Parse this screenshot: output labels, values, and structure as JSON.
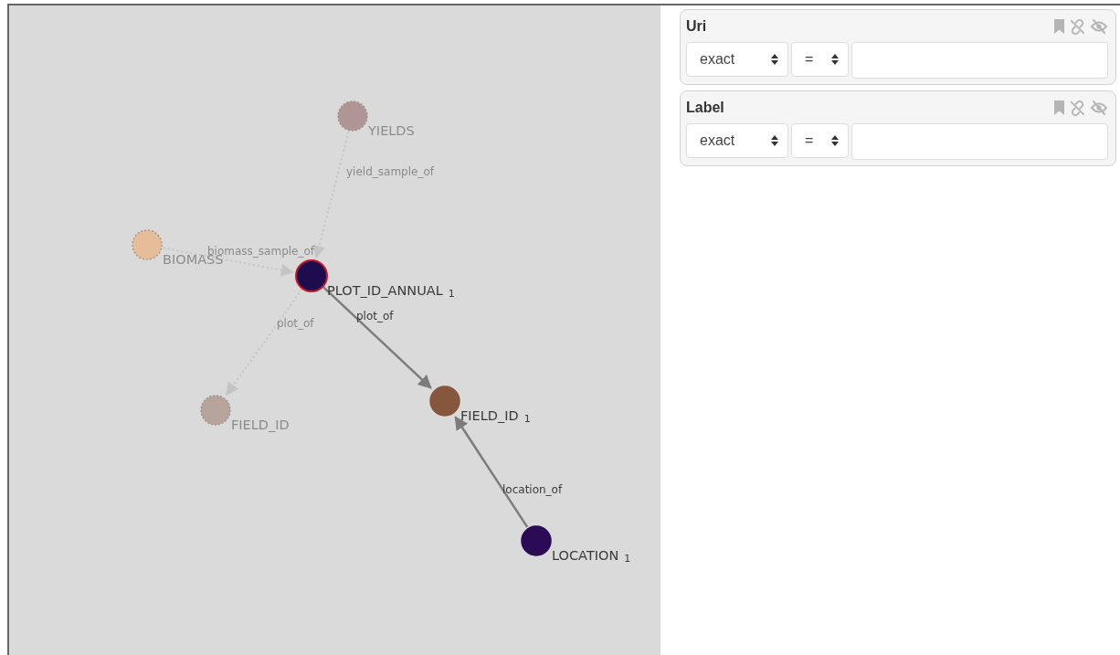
{
  "graph": {
    "nodes": [
      {
        "label": "YIELDS",
        "color": "#a98a8a",
        "faded": true,
        "selected": false
      },
      {
        "label": "BIOMASS",
        "color": "#e8b98e",
        "faded": true,
        "selected": false
      },
      {
        "label": "PLOT_ID_ANNUAL",
        "count": "1",
        "color": "#1e0d4e",
        "faded": false,
        "selected": true
      },
      {
        "label": "FIELD_ID",
        "color": "#b09b92",
        "faded": true,
        "selected": false
      },
      {
        "label": "FIELD_ID",
        "count": "1",
        "color": "#86573c",
        "faded": false,
        "selected": false
      },
      {
        "label": "LOCATION",
        "count": "1",
        "color": "#2c0b56",
        "faded": false,
        "selected": false
      }
    ],
    "edges": [
      {
        "label": "yield_sample_of",
        "faded": true
      },
      {
        "label": "biomass_sample_of",
        "faded": true
      },
      {
        "label": "plot_of",
        "faded": true
      },
      {
        "label": "plot_of",
        "faded": false
      },
      {
        "label": "location_of",
        "faded": false
      }
    ]
  },
  "filters": [
    {
      "title": "Uri",
      "match": "exact",
      "operator": "="
    },
    {
      "title": "Label",
      "match": "exact",
      "operator": "="
    }
  ]
}
